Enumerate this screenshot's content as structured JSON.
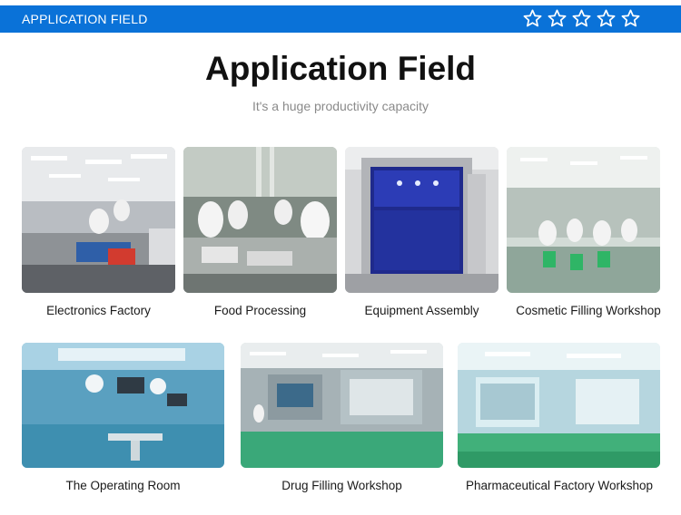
{
  "header": {
    "label": "APPLICATION FIELD",
    "star_count": 5,
    "bar_color": "#0a72d8"
  },
  "title": "Application Field",
  "subtitle": "It's a huge productivity capacity",
  "applications": [
    {
      "caption": "Electronics Factory"
    },
    {
      "caption": "Food Processing"
    },
    {
      "caption": "Equipment Assembly"
    },
    {
      "caption": "Cosmetic Filling Workshop"
    },
    {
      "caption": "The Operating Room"
    },
    {
      "caption": "Drug Filling Workshop"
    },
    {
      "caption": "Pharmaceutical Factory Workshop"
    }
  ]
}
